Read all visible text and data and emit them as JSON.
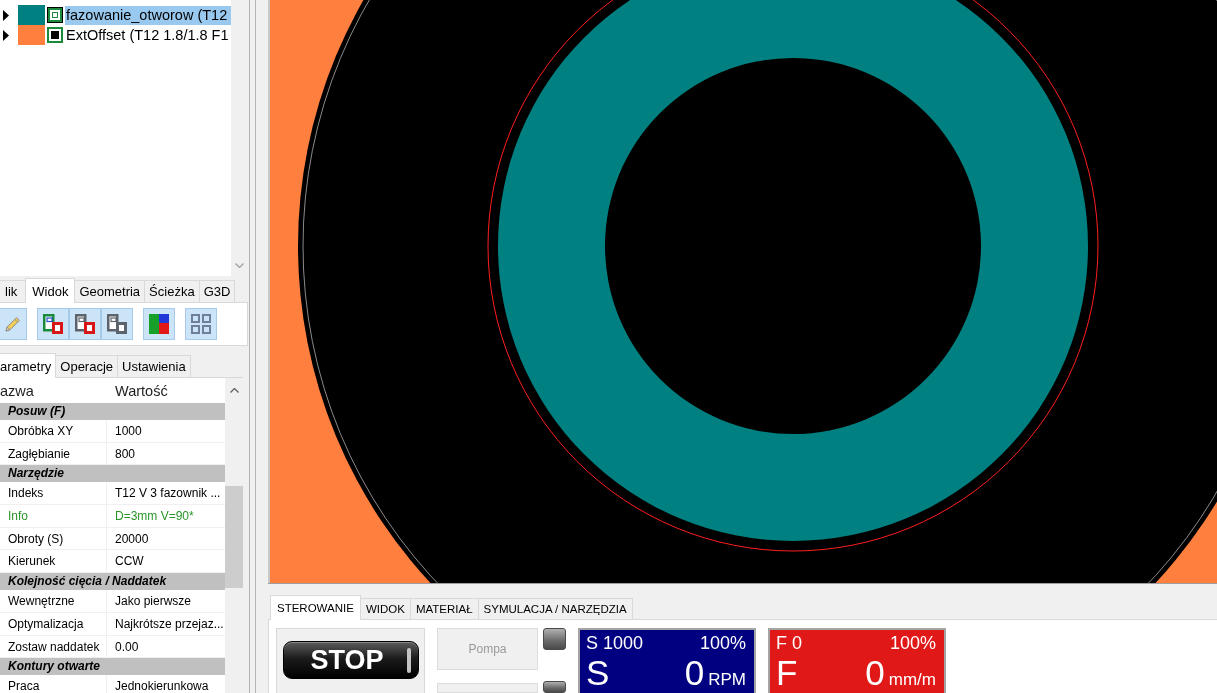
{
  "tree": {
    "items": [
      {
        "label": "fazowanie_otworow (T12",
        "color": "#008080",
        "checked": false,
        "selected": true,
        "expanded": false
      },
      {
        "label": "ExtOffset (T12 1.8/1.8 F1",
        "color": "#ff7f3f",
        "checked": true,
        "selected": false,
        "expanded": false
      }
    ]
  },
  "left_tabs": [
    {
      "label": "lik",
      "selected": false
    },
    {
      "label": "Widok",
      "selected": true
    },
    {
      "label": "Geometria",
      "selected": false
    },
    {
      "label": "Ścieżka",
      "selected": false
    },
    {
      "label": "G3D",
      "selected": false
    }
  ],
  "toolbar": {
    "groups": [
      {
        "buttons": [
          {
            "kind": "edit"
          }
        ]
      },
      {
        "buttons": [
          {
            "kind": "layers"
          },
          {
            "kind": "layersdim"
          },
          {
            "kind": "layersoff"
          }
        ]
      },
      {
        "buttons": [
          {
            "kind": "colors"
          }
        ]
      },
      {
        "buttons": [
          {
            "kind": "grid"
          }
        ]
      }
    ]
  },
  "param_tabs": [
    {
      "label": "arametry",
      "selected": true
    },
    {
      "label": "Operacje",
      "selected": false
    },
    {
      "label": "Ustawienia",
      "selected": false
    }
  ],
  "properties": {
    "columns": [
      "azwa",
      "Wartość"
    ],
    "rows": [
      {
        "kind": "category",
        "label": "Posuw (F)"
      },
      {
        "kind": "property",
        "name": "Obróbka XY",
        "value": "1000"
      },
      {
        "kind": "property",
        "name": "Zagłębianie",
        "value": "800"
      },
      {
        "kind": "category",
        "label": "Narzędzie"
      },
      {
        "kind": "property",
        "name": "Indeks",
        "value": "T12 V 3 fazownik ..."
      },
      {
        "kind": "info",
        "name": "Info",
        "value": "D=3mm V=90*"
      },
      {
        "kind": "property",
        "name": "Obroty (S)",
        "value": "20000"
      },
      {
        "kind": "property",
        "name": "Kierunek",
        "value": "CCW"
      },
      {
        "kind": "category",
        "label": "Kolejność cięcia / Naddatek"
      },
      {
        "kind": "property",
        "name": "Wewnętrzne",
        "value": "Jako pierwsze"
      },
      {
        "kind": "property",
        "name": "Optymalizacja",
        "value": "Najkrótsze przejaz..."
      },
      {
        "kind": "property",
        "name": "Zostaw naddatek",
        "value": "0.00"
      },
      {
        "kind": "category",
        "label": "Kontury otwarte"
      },
      {
        "kind": "property",
        "name": "Praca",
        "value": "Jednokierunkowa"
      }
    ]
  },
  "bottom_tabs": [
    {
      "label": "STEROWANIE",
      "selected": true
    },
    {
      "label": "WIDOK",
      "selected": false
    },
    {
      "label": "MATERIAŁ",
      "selected": false
    },
    {
      "label": "SYMULACJA / NARZĘDZIA",
      "selected": false
    }
  ],
  "controls": {
    "stop": "STOP",
    "switches": [
      {
        "label": "Pompa",
        "disabled": true,
        "on": false
      },
      {
        "on": false
      }
    ]
  },
  "readouts": [
    {
      "label": "S 1000",
      "override": "100%",
      "symbol": "S",
      "value": "0",
      "unit": "RPM",
      "color": "#000080"
    },
    {
      "label": "F 0",
      "override": "100%",
      "symbol": "F",
      "value": "0",
      "unit": "mm/m",
      "color": "#e01818"
    }
  ]
}
